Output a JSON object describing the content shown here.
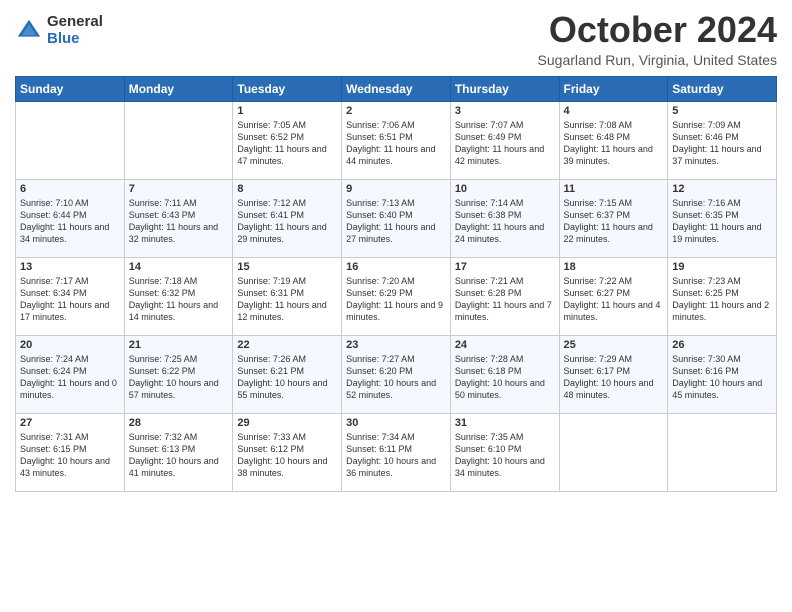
{
  "header": {
    "logo": {
      "general": "General",
      "blue": "Blue"
    },
    "title": "October 2024",
    "location": "Sugarland Run, Virginia, United States"
  },
  "days_of_week": [
    "Sunday",
    "Monday",
    "Tuesday",
    "Wednesday",
    "Thursday",
    "Friday",
    "Saturday"
  ],
  "weeks": [
    [
      {
        "day": "",
        "info": ""
      },
      {
        "day": "",
        "info": ""
      },
      {
        "day": "1",
        "info": "Sunrise: 7:05 AM\nSunset: 6:52 PM\nDaylight: 11 hours and 47 minutes."
      },
      {
        "day": "2",
        "info": "Sunrise: 7:06 AM\nSunset: 6:51 PM\nDaylight: 11 hours and 44 minutes."
      },
      {
        "day": "3",
        "info": "Sunrise: 7:07 AM\nSunset: 6:49 PM\nDaylight: 11 hours and 42 minutes."
      },
      {
        "day": "4",
        "info": "Sunrise: 7:08 AM\nSunset: 6:48 PM\nDaylight: 11 hours and 39 minutes."
      },
      {
        "day": "5",
        "info": "Sunrise: 7:09 AM\nSunset: 6:46 PM\nDaylight: 11 hours and 37 minutes."
      }
    ],
    [
      {
        "day": "6",
        "info": "Sunrise: 7:10 AM\nSunset: 6:44 PM\nDaylight: 11 hours and 34 minutes."
      },
      {
        "day": "7",
        "info": "Sunrise: 7:11 AM\nSunset: 6:43 PM\nDaylight: 11 hours and 32 minutes."
      },
      {
        "day": "8",
        "info": "Sunrise: 7:12 AM\nSunset: 6:41 PM\nDaylight: 11 hours and 29 minutes."
      },
      {
        "day": "9",
        "info": "Sunrise: 7:13 AM\nSunset: 6:40 PM\nDaylight: 11 hours and 27 minutes."
      },
      {
        "day": "10",
        "info": "Sunrise: 7:14 AM\nSunset: 6:38 PM\nDaylight: 11 hours and 24 minutes."
      },
      {
        "day": "11",
        "info": "Sunrise: 7:15 AM\nSunset: 6:37 PM\nDaylight: 11 hours and 22 minutes."
      },
      {
        "day": "12",
        "info": "Sunrise: 7:16 AM\nSunset: 6:35 PM\nDaylight: 11 hours and 19 minutes."
      }
    ],
    [
      {
        "day": "13",
        "info": "Sunrise: 7:17 AM\nSunset: 6:34 PM\nDaylight: 11 hours and 17 minutes."
      },
      {
        "day": "14",
        "info": "Sunrise: 7:18 AM\nSunset: 6:32 PM\nDaylight: 11 hours and 14 minutes."
      },
      {
        "day": "15",
        "info": "Sunrise: 7:19 AM\nSunset: 6:31 PM\nDaylight: 11 hours and 12 minutes."
      },
      {
        "day": "16",
        "info": "Sunrise: 7:20 AM\nSunset: 6:29 PM\nDaylight: 11 hours and 9 minutes."
      },
      {
        "day": "17",
        "info": "Sunrise: 7:21 AM\nSunset: 6:28 PM\nDaylight: 11 hours and 7 minutes."
      },
      {
        "day": "18",
        "info": "Sunrise: 7:22 AM\nSunset: 6:27 PM\nDaylight: 11 hours and 4 minutes."
      },
      {
        "day": "19",
        "info": "Sunrise: 7:23 AM\nSunset: 6:25 PM\nDaylight: 11 hours and 2 minutes."
      }
    ],
    [
      {
        "day": "20",
        "info": "Sunrise: 7:24 AM\nSunset: 6:24 PM\nDaylight: 11 hours and 0 minutes."
      },
      {
        "day": "21",
        "info": "Sunrise: 7:25 AM\nSunset: 6:22 PM\nDaylight: 10 hours and 57 minutes."
      },
      {
        "day": "22",
        "info": "Sunrise: 7:26 AM\nSunset: 6:21 PM\nDaylight: 10 hours and 55 minutes."
      },
      {
        "day": "23",
        "info": "Sunrise: 7:27 AM\nSunset: 6:20 PM\nDaylight: 10 hours and 52 minutes."
      },
      {
        "day": "24",
        "info": "Sunrise: 7:28 AM\nSunset: 6:18 PM\nDaylight: 10 hours and 50 minutes."
      },
      {
        "day": "25",
        "info": "Sunrise: 7:29 AM\nSunset: 6:17 PM\nDaylight: 10 hours and 48 minutes."
      },
      {
        "day": "26",
        "info": "Sunrise: 7:30 AM\nSunset: 6:16 PM\nDaylight: 10 hours and 45 minutes."
      }
    ],
    [
      {
        "day": "27",
        "info": "Sunrise: 7:31 AM\nSunset: 6:15 PM\nDaylight: 10 hours and 43 minutes."
      },
      {
        "day": "28",
        "info": "Sunrise: 7:32 AM\nSunset: 6:13 PM\nDaylight: 10 hours and 41 minutes."
      },
      {
        "day": "29",
        "info": "Sunrise: 7:33 AM\nSunset: 6:12 PM\nDaylight: 10 hours and 38 minutes."
      },
      {
        "day": "30",
        "info": "Sunrise: 7:34 AM\nSunset: 6:11 PM\nDaylight: 10 hours and 36 minutes."
      },
      {
        "day": "31",
        "info": "Sunrise: 7:35 AM\nSunset: 6:10 PM\nDaylight: 10 hours and 34 minutes."
      },
      {
        "day": "",
        "info": ""
      },
      {
        "day": "",
        "info": ""
      }
    ]
  ]
}
